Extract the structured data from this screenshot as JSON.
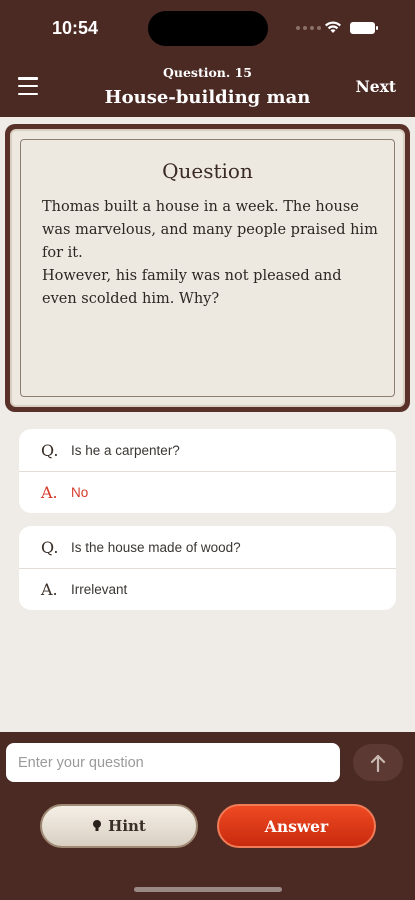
{
  "status": {
    "time": "10:54"
  },
  "header": {
    "subtitle": "Question. 15",
    "title": "House-building man",
    "next_label": "Next",
    "menu_icon": "hamburger-menu-icon"
  },
  "question_card": {
    "heading": "Question",
    "lines": [
      "Thomas built a house in a week. The house was marvelous, and many people praised him for it.",
      "However, his family was not pleased and even scolded him. Why?"
    ]
  },
  "qa": [
    {
      "q_letter": "Q.",
      "question": "Is he a carpenter?",
      "a_letter": "A.",
      "answer": "No",
      "answer_color": "#d63a2a"
    },
    {
      "q_letter": "Q.",
      "question": "Is the house made of wood?",
      "a_letter": "A.",
      "answer": "Irrelevant",
      "answer_color": "#3a3633"
    }
  ],
  "composer": {
    "placeholder": "Enter your question",
    "send_icon": "arrow-up-icon"
  },
  "actions": {
    "hint_label": "Hint",
    "hint_icon": "lightbulb-icon",
    "answer_label": "Answer"
  },
  "colors": {
    "brand_brown": "#4b2a24",
    "answer_red": "#d63a2a",
    "answer_button": "#e23d1a"
  }
}
